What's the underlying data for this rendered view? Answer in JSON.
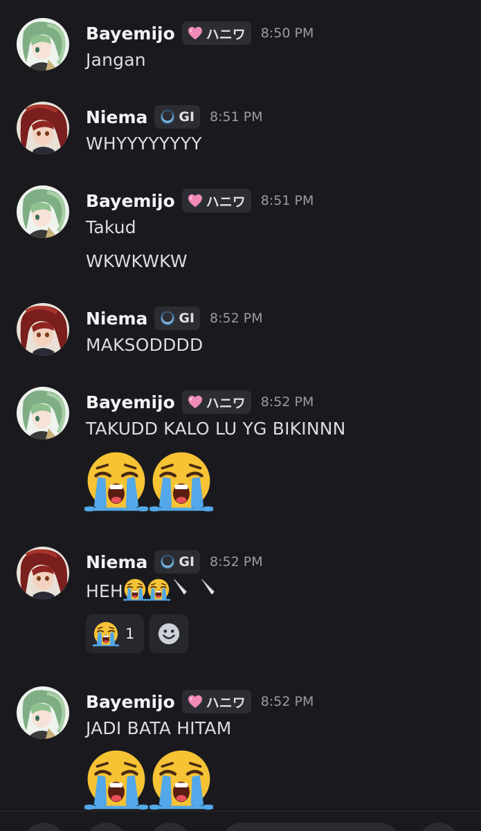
{
  "users": {
    "bayemijo": {
      "name": "Bayemijo",
      "tag": "ハニワ",
      "tag_icon": "pink-heart-icon",
      "avatar": "green-haired-character-avatar"
    },
    "niema": {
      "name": "Niema",
      "tag": "GI",
      "tag_icon": "blue-moon-icon",
      "avatar": "red-haired-character-avatar"
    }
  },
  "messages": [
    {
      "author": "Bayemijo",
      "tag": "ハニワ",
      "time": "8:50 PM",
      "lines": [
        "Jangan"
      ]
    },
    {
      "author": "Niema",
      "tag": "GI",
      "time": "8:51 PM",
      "lines": [
        "WHYYYYYYYY"
      ]
    },
    {
      "author": "Bayemijo",
      "tag": "ハニワ",
      "time": "8:51 PM",
      "lines": [
        "Takud",
        "WKWKWKW"
      ]
    },
    {
      "author": "Niema",
      "tag": "GI",
      "time": "8:52 PM",
      "lines": [
        "MAKSODDDD"
      ]
    },
    {
      "author": "Bayemijo",
      "tag": "ハニワ",
      "time": "8:52 PM",
      "lines": [
        "TAKUDD KALO LU YG BIKINNN"
      ],
      "big_emojis": [
        "loudly-crying-face",
        "loudly-crying-face"
      ]
    },
    {
      "author": "Niema",
      "tag": "GI",
      "time": "8:52 PM",
      "lines": [
        "HEH"
      ],
      "inline_emojis": [
        "loudly-crying-face",
        "loudly-crying-face",
        "kitchen-knife",
        "kitchen-knife"
      ],
      "reactions": [
        {
          "emoji": "loudly-crying-face",
          "count": "1"
        }
      ],
      "add_reaction_icon": "add-reaction-smiley-icon"
    },
    {
      "author": "Bayemijo",
      "tag": "ハニワ",
      "time": "8:52 PM",
      "lines": [
        "JADI BATA HITAM"
      ],
      "big_emojis": [
        "loudly-crying-face",
        "loudly-crying-face"
      ]
    }
  ],
  "colors": {
    "background": "#1a1a1e",
    "tag_background": "#2c2d33",
    "timestamp": "#9a9ca5",
    "username": "#f2f3f5",
    "message_text": "#dcdde1",
    "reaction_background": "#27282e"
  }
}
